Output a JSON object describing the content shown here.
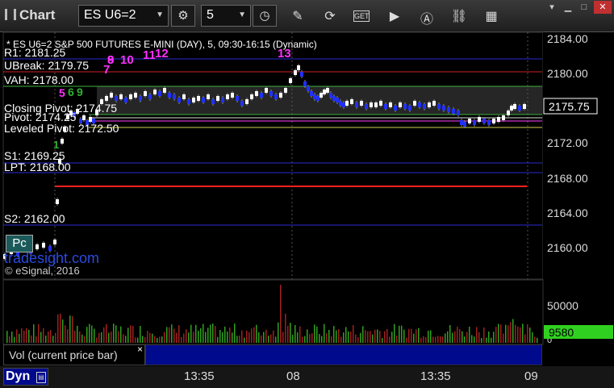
{
  "toolbar": {
    "title": "Chart",
    "symbol": "ES U6=2",
    "interval": "5"
  },
  "chart": {
    "header": "* ES U6=2  S&P 500 FUTURES E-MINI (DAY), 5, 09:30-16:15 (Dynamic)",
    "current_price": "2175.75",
    "levels": [
      {
        "label": "R1: 2181.25",
        "color": "#3a3aff"
      },
      {
        "label": "UBreak: 2179.75",
        "color": "#ff3030"
      },
      {
        "label": "VAH: 2178.00",
        "color": "#40c040"
      },
      {
        "label": "Closing Pivot: 2174.75",
        "color": "#ffffff"
      },
      {
        "label": "Pivot: 2174.25",
        "color": "#ffffff"
      },
      {
        "label": "Leveled Pivot: 2172.50",
        "color": "#e0e060"
      },
      {
        "label": "S1: 2169.25",
        "color": "#3a3aff"
      },
      {
        "label": "LPT: 2168.00",
        "color": "#3a3aff"
      },
      {
        "label": "S2: 2162.00",
        "color": "#3a3aff"
      }
    ],
    "price_axis": [
      "2184.00",
      "2180.00",
      "2176.00",
      "2172.00",
      "2168.00",
      "2164.00",
      "2160.00"
    ],
    "counts": [
      "7",
      "8",
      "9",
      "10",
      "11",
      "12",
      "13",
      "5",
      "6",
      "9",
      "1"
    ],
    "watermark": "tradesight.com",
    "copyright": "© eSignal, 2016",
    "pc_button": "Pc"
  },
  "volume": {
    "label": "Vol (current price bar)",
    "close_glyph": "×",
    "axis": [
      "50000",
      "0"
    ],
    "current": "9580"
  },
  "time_axis": [
    "13:35",
    "08",
    "13:35",
    "09"
  ],
  "bottom": {
    "tab": "Dyn"
  }
}
